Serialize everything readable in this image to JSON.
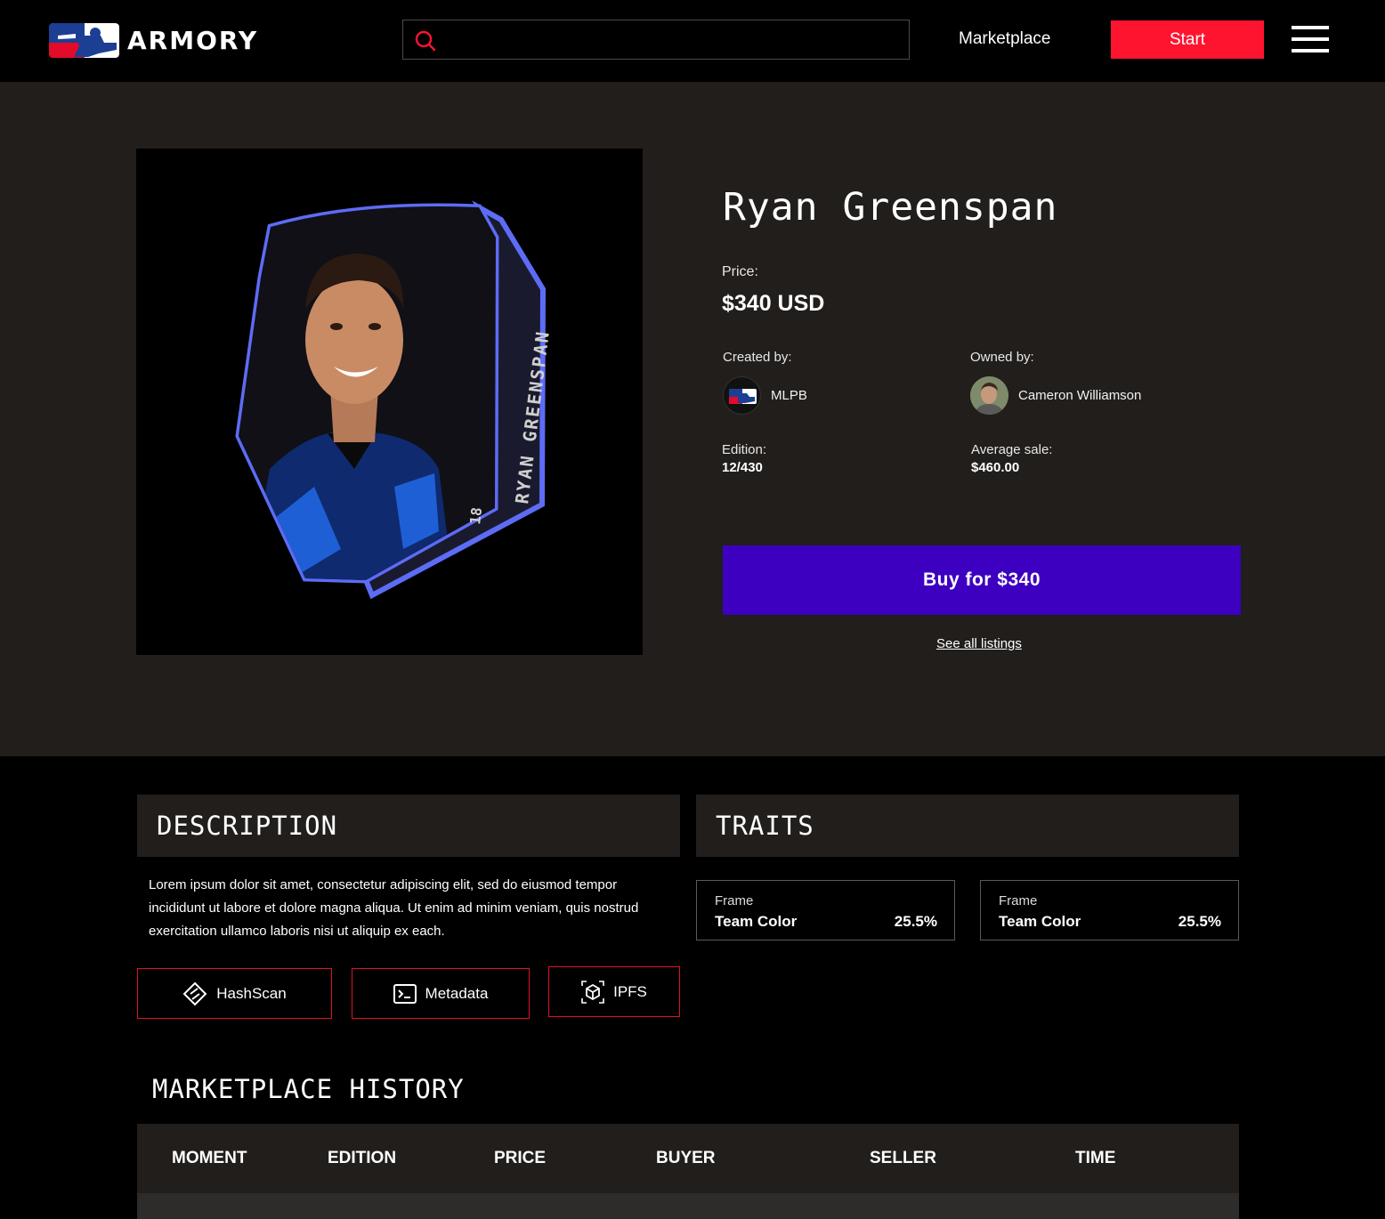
{
  "header": {
    "logo_text": "ARMORY",
    "search": {
      "value": "",
      "placeholder": ""
    },
    "nav_marketplace": "Marketplace",
    "start_label": "Start"
  },
  "colors": {
    "accent_red": "#ff1430",
    "buy_purple": "#3d00c0",
    "card_frame": "#5d6cf5",
    "panel_bg": "#211e1c"
  },
  "item": {
    "title": "Ryan  Greenspan",
    "price_label": "Price:",
    "price": "$340 USD",
    "created_label": "Created by:",
    "creator_name": "MLPB",
    "owned_label": "Owned by:",
    "owner_name": "Cameron Williamson",
    "edition_label": "Edition:",
    "edition": "12/430",
    "avg_label": "Average sale:",
    "avg_sale": "$460.00",
    "buy_label": "Buy for $340",
    "see_all": "See all listings",
    "card_side_text": "RYAN GREENSPAN",
    "card_number": "18"
  },
  "description": {
    "heading": "DESCRIPTION",
    "text": "Lorem ipsum dolor sit amet, consectetur adipiscing elit, sed do eiusmod tempor incididunt ut labore et dolore magna aliqua. Ut enim ad minim veniam, quis nostrud exercitation ullamco laboris nisi ut aliquip ex each.",
    "links": [
      {
        "label": "HashScan",
        "icon": "hashscan-icon"
      },
      {
        "label": "Metadata",
        "icon": "terminal-icon"
      },
      {
        "label": "IPFS",
        "icon": "cube-icon"
      }
    ]
  },
  "traits": {
    "heading": "TRAITS",
    "items": [
      {
        "type": "Frame",
        "value": "Team Color",
        "percent": "25.5%"
      },
      {
        "type": "Frame",
        "value": "Team Color",
        "percent": "25.5%"
      }
    ]
  },
  "history": {
    "heading": "MARKETPLACE HISTORY",
    "columns": [
      "MOMENT",
      "EDITION",
      "PRICE",
      "BUYER",
      "SELLER",
      "TIME"
    ]
  }
}
